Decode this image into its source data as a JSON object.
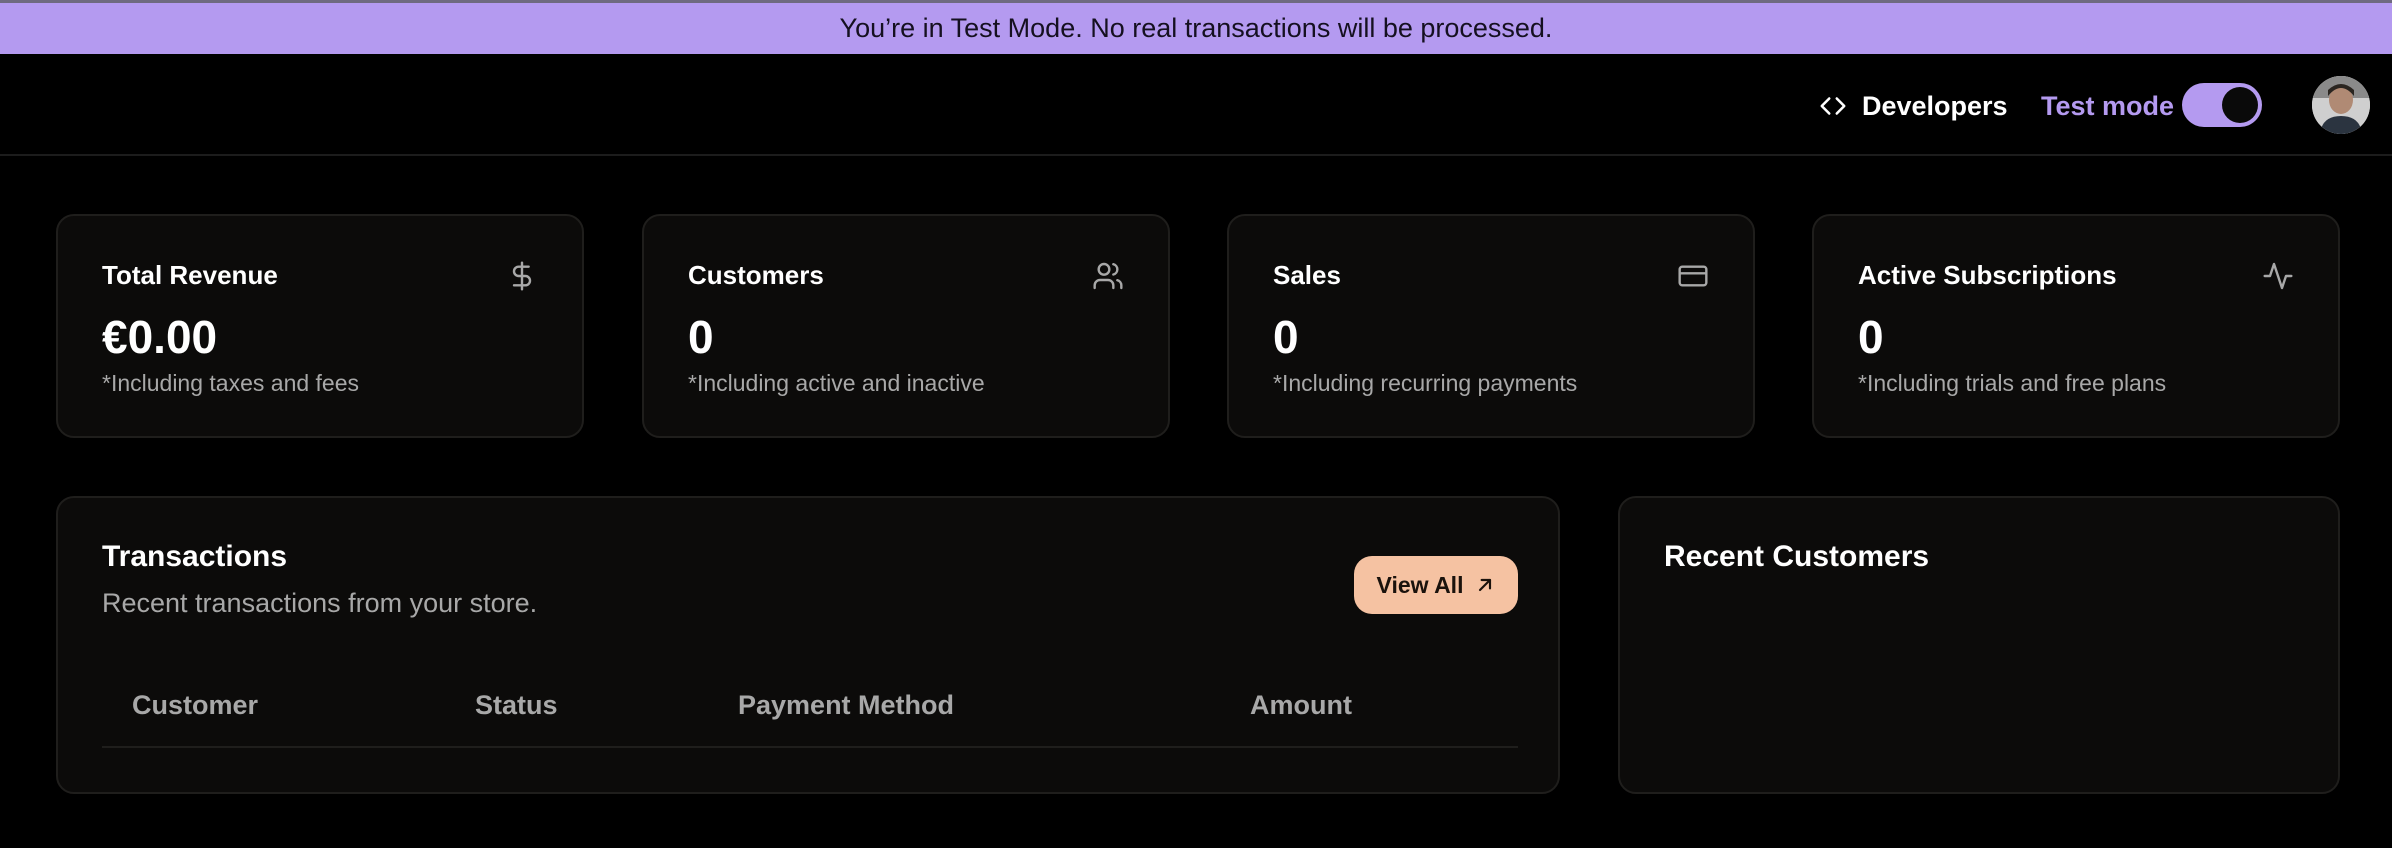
{
  "banner": {
    "text": "You’re in Test Mode. No real transactions will be processed."
  },
  "topbar": {
    "developers_label": "Developers",
    "test_mode_label": "Test mode",
    "test_mode_on": true
  },
  "stats": [
    {
      "title": "Total Revenue",
      "value": "€0.00",
      "note": "*Including taxes and fees",
      "icon": "dollar-icon"
    },
    {
      "title": "Customers",
      "value": "0",
      "note": "*Including active and inactive",
      "icon": "users-icon"
    },
    {
      "title": "Sales",
      "value": "0",
      "note": "*Including recurring payments",
      "icon": "credit-card-icon"
    },
    {
      "title": "Active Subscriptions",
      "value": "0",
      "note": "*Including trials and free plans",
      "icon": "activity-icon"
    }
  ],
  "transactions": {
    "title": "Transactions",
    "subtitle": "Recent transactions from your store.",
    "view_all_label": "View All",
    "columns": [
      "Customer",
      "Status",
      "Payment Method",
      "Amount"
    ]
  },
  "recent_customers": {
    "title": "Recent Customers"
  },
  "colors": {
    "accent": "#b49af0",
    "button": "#f5c2a2",
    "background": "#000000",
    "card": "#0c0b0a"
  }
}
